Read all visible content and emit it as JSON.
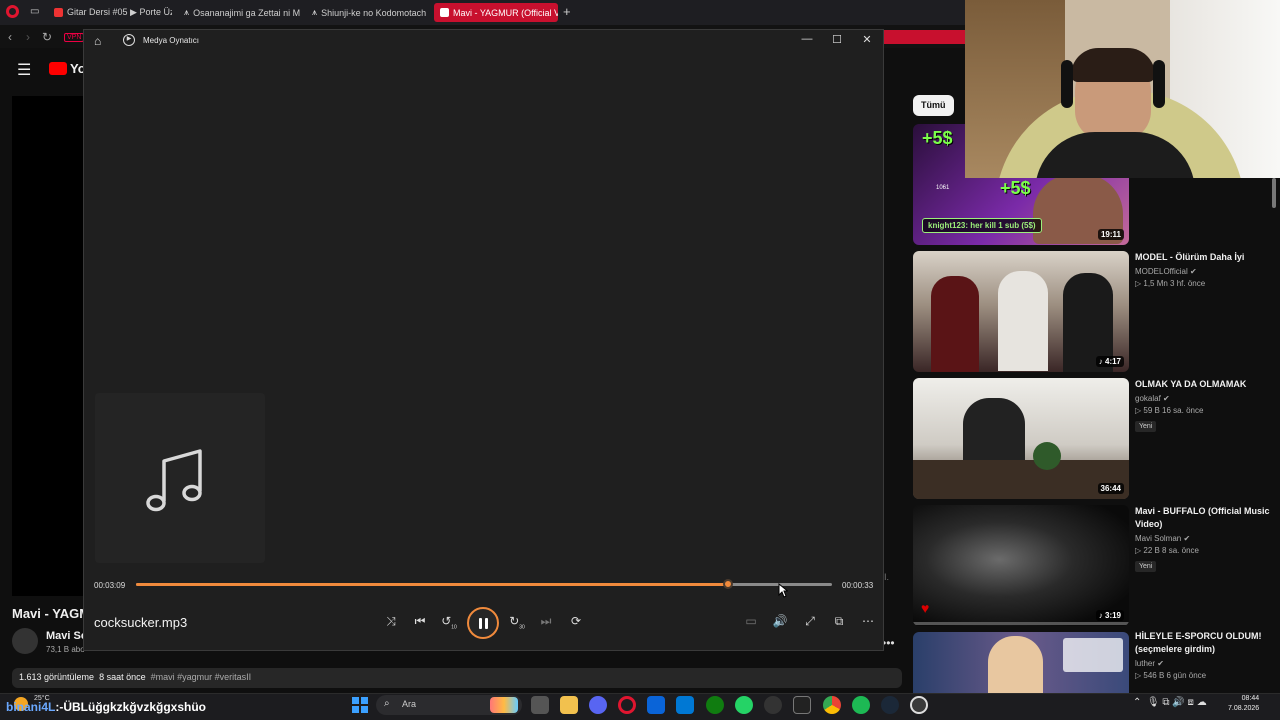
{
  "browser": {
    "tabs": [
      {
        "label": "Gitar Dersi #05 ▶ Porte Üz",
        "active": false,
        "icon": "youtube-icon"
      },
      {
        "label": "Osananajimi ga Zettai ni M",
        "active": false,
        "icon": "k-icon"
      },
      {
        "label": "Shiunji-ke no Kodomotach",
        "active": false,
        "icon": "k-icon"
      },
      {
        "label": "Mavi - YAGMUR (Official V",
        "active": true,
        "icon": "youtube-icon"
      }
    ],
    "new_tab": "+",
    "vpn": "VPN"
  },
  "youtube": {
    "logo_text": "You",
    "video_title": "Mavi - YAGM",
    "channel_name": "Mavi So",
    "channel_subs": "73,1 B abo",
    "views": "1.613 görüntüleme",
    "age": "8 saat önce",
    "tags": "#mavi #yagmur #veritasII",
    "side_letter": "I.",
    "chip_all": "Tümü",
    "more": "•••"
  },
  "media_player": {
    "title": "Medya Oynatıcı",
    "filename": "cocksucker.mp3",
    "elapsed": "00:03:09",
    "remaining": "00:00:33",
    "progress": 0.85,
    "state": "playing",
    "accent": "#f08a3c",
    "window_controls": {
      "minimize": "—",
      "maximize": "☐",
      "close": "✕"
    },
    "controls": {
      "shuffle": "⤨",
      "previous": "⏮",
      "back10": "↺",
      "forward30": "↻",
      "next": "⏭",
      "repeat": "⟳",
      "miniplayer": "▭",
      "volume": "🔊",
      "fullscreen": "⤢",
      "compact": "⧉",
      "more": "⋯"
    },
    "back10_label": "10",
    "forward30_label": "30"
  },
  "sidebar_videos": [
    {
      "title": "",
      "channel": "",
      "stats": "",
      "badge": "",
      "duration": "19:11",
      "sponsor_text": "knight123: her kill 1 sub (5$)",
      "five_a": "+5$",
      "five_b": "+5$",
      "small": "1061"
    },
    {
      "title": "MODEL - Ölürüm Daha İyi",
      "channel": "MODELOfficial",
      "stats": "▷ 1,5 Mn  3 hf. önce",
      "badge": "",
      "duration": "♪ 4:17"
    },
    {
      "title": "OLMAK YA DA OLMAMAK",
      "channel": "gokalaf",
      "stats": "▷ 59 B  16 sa. önce",
      "badge": "Yeni",
      "duration": "36:44"
    },
    {
      "title": "Mavi - BUFFALO (Official Music Video)",
      "channel": "Mavi Solman",
      "stats": "▷ 22 B  8 sa. önce",
      "badge": "Yeni",
      "duration": "♪ 3:19"
    },
    {
      "title": "HİLEYLE E-SPORCU OLDUM! (seçmelere girdim)",
      "channel": "luther",
      "stats": "▷ 546 B  6 gün önce",
      "badge": "",
      "duration": ""
    }
  ],
  "taskbar": {
    "weather_temp": "25°C",
    "ticker_prefix": "binani4L",
    "ticker": ":-ÜBLüğgkzkğvzkğgxshüo",
    "search_placeholder": "Ara",
    "time": "08:44",
    "date": "7.08.2026"
  }
}
